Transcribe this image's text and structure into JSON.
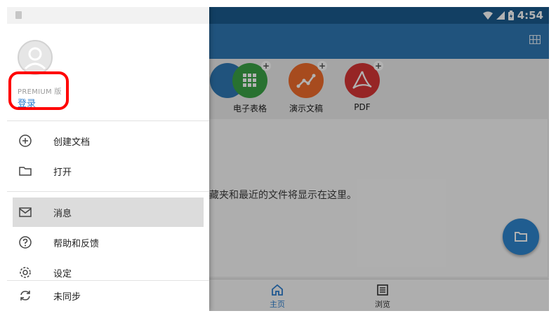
{
  "status_bar": {
    "time": "4:54"
  },
  "quick_create": [
    {
      "label": "电子表格",
      "color": "#3aa246"
    },
    {
      "label": "演示文稿",
      "color": "#ef6c2c"
    },
    {
      "label": "PDF",
      "color": "#d73636"
    }
  ],
  "main": {
    "empty_message": "藏夹和最近的文件将显示在这里。"
  },
  "bottom_nav": {
    "home": "主页",
    "browse": "浏览"
  },
  "drawer": {
    "premium_label": "PREMIUM 版",
    "login_label": "登录",
    "menu": {
      "create": "创建文档",
      "open": "打开",
      "messages": "消息",
      "help": "帮助和反馈",
      "settings": "设定",
      "sync": "未同步"
    }
  },
  "colors": {
    "status_bar": "#1b5b8e",
    "app_bar": "#2f78b4",
    "accent": "#2d7fcf",
    "highlight": "#ff0000"
  }
}
